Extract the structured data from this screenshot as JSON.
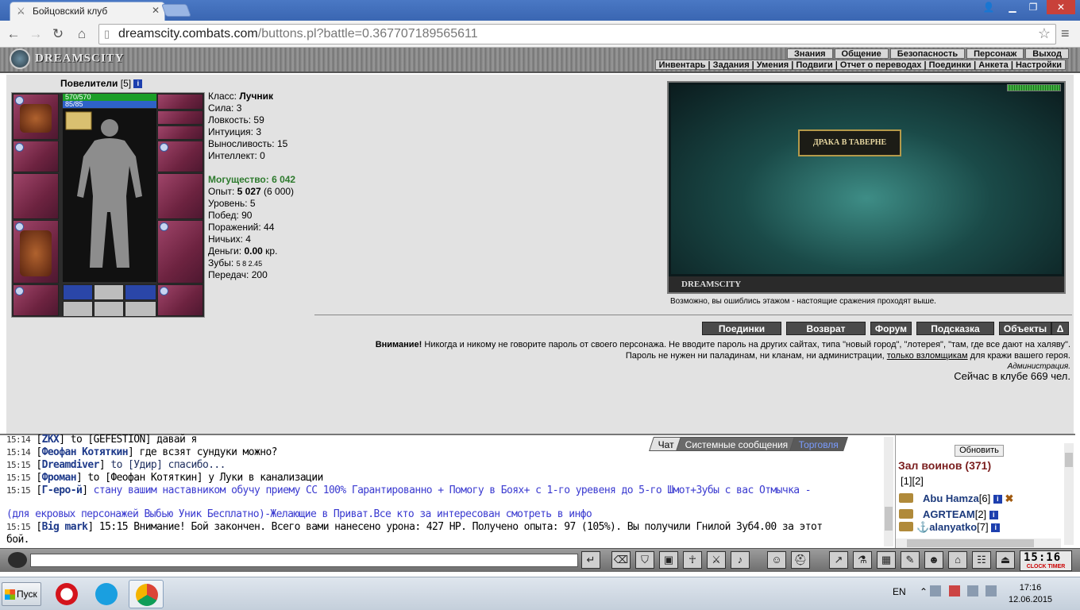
{
  "browser": {
    "tab_title": "Бойцовский клуб",
    "url_host": "dreamscity.combats.com",
    "url_path": "/buttons.pl?battle=0.367707189565611"
  },
  "game_header": {
    "logo": "DREAMSCITY",
    "top_menu": [
      "Знания",
      "Общение",
      "Безопасность",
      "Персонаж",
      "Выход"
    ],
    "sub_menu": "Инвентарь | Задания | Умения | Подвиги | Отчет о переводах | Поединки | Анкета | Настройки"
  },
  "character": {
    "name": "Повелители",
    "level_tag": "[5]",
    "hp": "570/570",
    "mana": "85/85",
    "stats": {
      "class_label": "Класс:",
      "class_value": "Лучник",
      "strength": "Сила: 3",
      "agility": "Ловкость: 59",
      "intuition": "Интуиция: 3",
      "endurance": "Выносливость: 15",
      "intellect": "Интеллект: 0",
      "power_label": "Могущество:",
      "power_value": "6 042",
      "exp_label": "Опыт:",
      "exp_value": "5 027",
      "exp_next": "(6 000)",
      "level": "Уровень: 5",
      "wins": "Побед: 90",
      "losses": "Поражений: 44",
      "draws": "Ничьих: 4",
      "money_label": "Деньги:",
      "money_value": "0.00",
      "money_unit": "кр.",
      "teeth_label": "Зубы:",
      "teeth_values": "5 8 2.45",
      "transfers": "Передач: 200"
    }
  },
  "arena": {
    "banner": "ДРАКА В ТАВЕРНЕ",
    "footer_logo": "DREAMSCITY",
    "message": "Возможно, вы ошиблись этажом - настоящие сражения проходят выше."
  },
  "buttons": [
    "Поединки",
    "Возврат",
    "Форум",
    "Подсказка",
    "Объекты",
    "Δ"
  ],
  "warning": {
    "bold": "Внимание!",
    "line1": "Никогда и никому не говорите пароль от своего персонажа. Не вводите пароль на других сайтах, типа \"новый город\", \"лотерея\", \"там, где все дают на халяву\".",
    "line2_pre": "Пароль не нужен ни паладинам, ни кланам, ни администрации,",
    "line2_link": "только взломщикам",
    "line2_post": "для кражи вашего героя.",
    "signature": "Администрация."
  },
  "online": "Сейчас в клубе 669 чел.",
  "chat_tabs": [
    "Чат",
    "Системные сообщения",
    "Торговля"
  ],
  "chat": [
    {
      "time": "15:14",
      "name": "ZKX",
      "text": " to [GEFESTION] давай я"
    },
    {
      "time": "15:14",
      "name": "Феофан Котяткин",
      "text": " где всзят сундуки можно?"
    },
    {
      "time": "15:15",
      "name": "Dreamdiver",
      "text": " to [Удир] спасибо..."
    },
    {
      "time": "15:15",
      "name": "Фроман",
      "text": " to [Феофан Котяткин] у Луки в канализации"
    },
    {
      "time": "15:15",
      "name": "Г-еро-й",
      "text": " стану вашим наставником обучу приему СС 100% Гарантированно + Помогу в Боях+ с 1-го уревеня до 5-го Шмот+Зубы с вас Отмычка -"
    },
    {
      "time": "",
      "name": "",
      "text": "(для екровых персонажей Выбью Уник Бесплатно)-Желающие в Приват.Все кто за интересован смотреть в инфо"
    },
    {
      "time": "15:15",
      "name": "Big mark",
      "text": " 15:15 Внимание! Бой закончен. Всего вами нанесено урона: 427 HP. Получено опыта: 97 (105%). Вы получили Гнилой Зуб4.00 за этот"
    },
    {
      "time": "",
      "name": "",
      "text": "бой."
    }
  ],
  "side": {
    "refresh": "Обновить",
    "hall_title": "Зал воинов (371)",
    "pages": "[1][2]",
    "players": [
      {
        "name": "Abu Hamza",
        "level": "[6]"
      },
      {
        "name": "AGRTEAM",
        "level": "[2]"
      },
      {
        "name": "alanyatko",
        "level": "[7]"
      }
    ]
  },
  "toolbar": {
    "clock": "15:16",
    "clock_label": "CLOCK TIMER"
  },
  "taskbar": {
    "start": "Пуск",
    "lang": "EN",
    "time": "17:16",
    "date": "12.06.2015"
  }
}
